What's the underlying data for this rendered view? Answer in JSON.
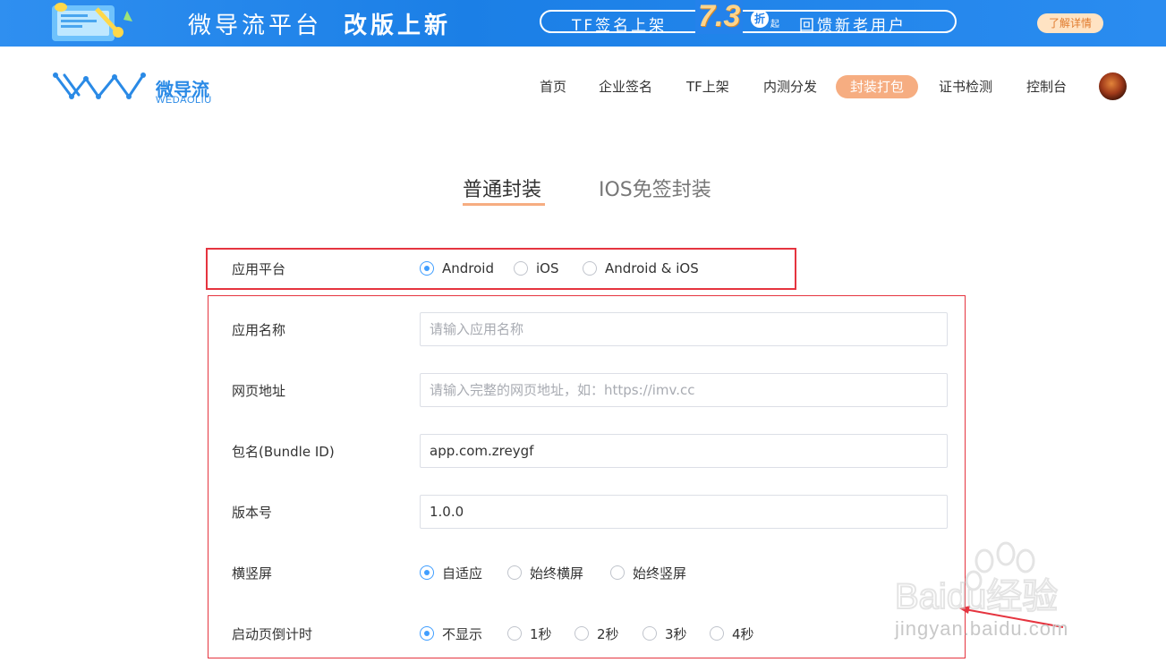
{
  "banner": {
    "title": "微导流平台",
    "title_bold": "改版上新",
    "promo_left": "TF签名上架",
    "promo_num": "7.3",
    "promo_zhe": "折",
    "promo_qi": "起",
    "promo_right": "回馈新老用户",
    "detail_button": "了解详情"
  },
  "logo": {
    "cn": "微导流",
    "en": "WEDAOLIU"
  },
  "nav": {
    "items": [
      "首页",
      "企业签名",
      "TF上架",
      "内测分发",
      "封装打包",
      "证书检测",
      "控制台"
    ],
    "active": "封装打包"
  },
  "tabs": {
    "normal": "普通封装",
    "ios_free": "IOS免签封装"
  },
  "form": {
    "platform": {
      "label": "应用平台",
      "options": [
        "Android",
        "iOS",
        "Android & iOS"
      ],
      "selected": "Android"
    },
    "app_name": {
      "label": "应用名称",
      "placeholder": "请输入应用名称",
      "value": ""
    },
    "web_url": {
      "label": "网页地址",
      "placeholder": "请输入完整的网页地址，如：https://imv.cc",
      "value": ""
    },
    "bundle_id": {
      "label": "包名(Bundle ID)",
      "value": "app.com.zreygf"
    },
    "version": {
      "label": "版本号",
      "value": "1.0.0"
    },
    "orientation": {
      "label": "横竖屏",
      "options": [
        "自适应",
        "始终横屏",
        "始终竖屏"
      ],
      "selected": "自适应"
    },
    "splash_timer": {
      "label": "启动页倒计时",
      "options": [
        "不显示",
        "1秒",
        "2秒",
        "3秒",
        "4秒"
      ],
      "selected": "不显示"
    }
  },
  "watermark": {
    "brand": "Baidu经验",
    "url": "jingyan.baidu.com"
  },
  "colors": {
    "accent": "#f6ad81",
    "radio": "#409eff",
    "annotation": "#e5343f",
    "banner": "#2482eb"
  }
}
